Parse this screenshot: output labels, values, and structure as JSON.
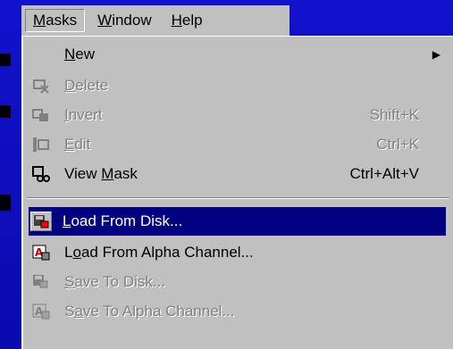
{
  "menubar": {
    "items": [
      {
        "label": "Masks",
        "mnemonic": "M",
        "active": true
      },
      {
        "label": "Window",
        "mnemonic": "W",
        "active": false
      },
      {
        "label": "Help",
        "mnemonic": "H",
        "active": false
      }
    ]
  },
  "menu": {
    "items": [
      {
        "label": "New",
        "shortcut": "",
        "icon": "none",
        "disabled": false,
        "submenu": true
      },
      {
        "label": "Delete",
        "shortcut": "",
        "icon": "delete-mask-icon",
        "disabled": true
      },
      {
        "label": "Invert",
        "shortcut": "Shift+K",
        "icon": "invert-mask-icon",
        "disabled": true
      },
      {
        "label": "Edit",
        "shortcut": "Ctrl+K",
        "icon": "edit-mask-icon",
        "disabled": true
      },
      {
        "label": "View Mask",
        "shortcut": "Ctrl+Alt+V",
        "icon": "view-mask-icon",
        "disabled": false
      },
      {
        "label": "Load From Disk...",
        "shortcut": "",
        "icon": "load-disk-icon",
        "disabled": false,
        "selected": true
      },
      {
        "label": "Load From Alpha Channel...",
        "shortcut": "",
        "icon": "load-alpha-icon",
        "disabled": false
      },
      {
        "label": "Save To Disk...",
        "shortcut": "",
        "icon": "save-disk-icon",
        "disabled": true
      },
      {
        "label": "Save To Alpha Channel...",
        "shortcut": "",
        "icon": "save-alpha-icon",
        "disabled": true
      }
    ]
  },
  "colors": {
    "selection": "#000080",
    "menu_bg": "#c0c0c0",
    "desktop": "#1010c8"
  }
}
